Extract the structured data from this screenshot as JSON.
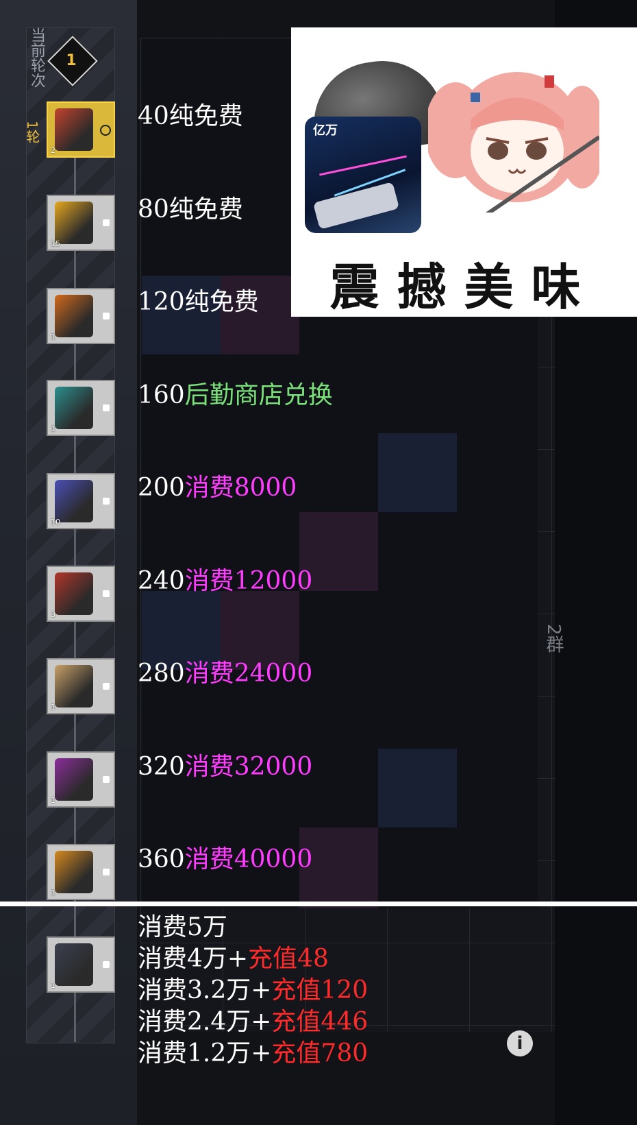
{
  "round_panel": {
    "label": "当前轮次",
    "current_round": "1",
    "round_tag": "1轮"
  },
  "rewards": [
    {
      "qty": "2",
      "state": "active",
      "icon_color": "#c4432d"
    },
    {
      "qty": "15",
      "state": "locked",
      "icon_color": "#e6a81e"
    },
    {
      "qty": "1",
      "state": "locked",
      "icon_color": "#d26a1a"
    },
    {
      "qty": "1",
      "state": "locked",
      "icon_color": "#2c8f8f"
    },
    {
      "qty": "10",
      "state": "locked",
      "icon_color": "#4a4fb6"
    },
    {
      "qty": "3",
      "state": "locked",
      "icon_color": "#b2362a"
    },
    {
      "qty": "1",
      "state": "locked",
      "icon_color": "#c8a067"
    },
    {
      "qty": "1",
      "state": "locked",
      "icon_color": "#8b2c9a"
    },
    {
      "qty": "1",
      "state": "locked",
      "icon_color": "#d68a1e"
    },
    {
      "qty": "1",
      "state": "locked",
      "icon_color": "#3b4050"
    }
  ],
  "notes": [
    {
      "num": "40",
      "desc": "纯免费",
      "color": "white"
    },
    {
      "num": "80",
      "desc": "纯免费",
      "color": "white"
    },
    {
      "num": "120",
      "desc": "纯免费",
      "color": "white"
    },
    {
      "num": "160",
      "desc": "后勤商店兑换",
      "color": "green"
    },
    {
      "num": "200",
      "desc": "消费8000",
      "color": "magenta"
    },
    {
      "num": "240",
      "desc": "消费12000",
      "color": "magenta"
    },
    {
      "num": "280",
      "desc": "消费24000",
      "color": "magenta"
    },
    {
      "num": "320",
      "desc": "消费32000",
      "color": "magenta"
    },
    {
      "num": "360",
      "desc": "消费40000",
      "color": "magenta"
    }
  ],
  "bottom_lines": [
    {
      "main": "消费5万",
      "extra": ""
    },
    {
      "main": "消费4万+",
      "extra": "充值48"
    },
    {
      "main": "消费3.2万+",
      "extra": "充值120"
    },
    {
      "main": "消费2.4万+",
      "extra": "充值446"
    },
    {
      "main": "消费1.2万+",
      "extra": "充值780"
    }
  ],
  "sticker": {
    "app_title": "亿万",
    "caption": "震撼美味"
  },
  "side_label": "2群",
  "info_icon": "i"
}
